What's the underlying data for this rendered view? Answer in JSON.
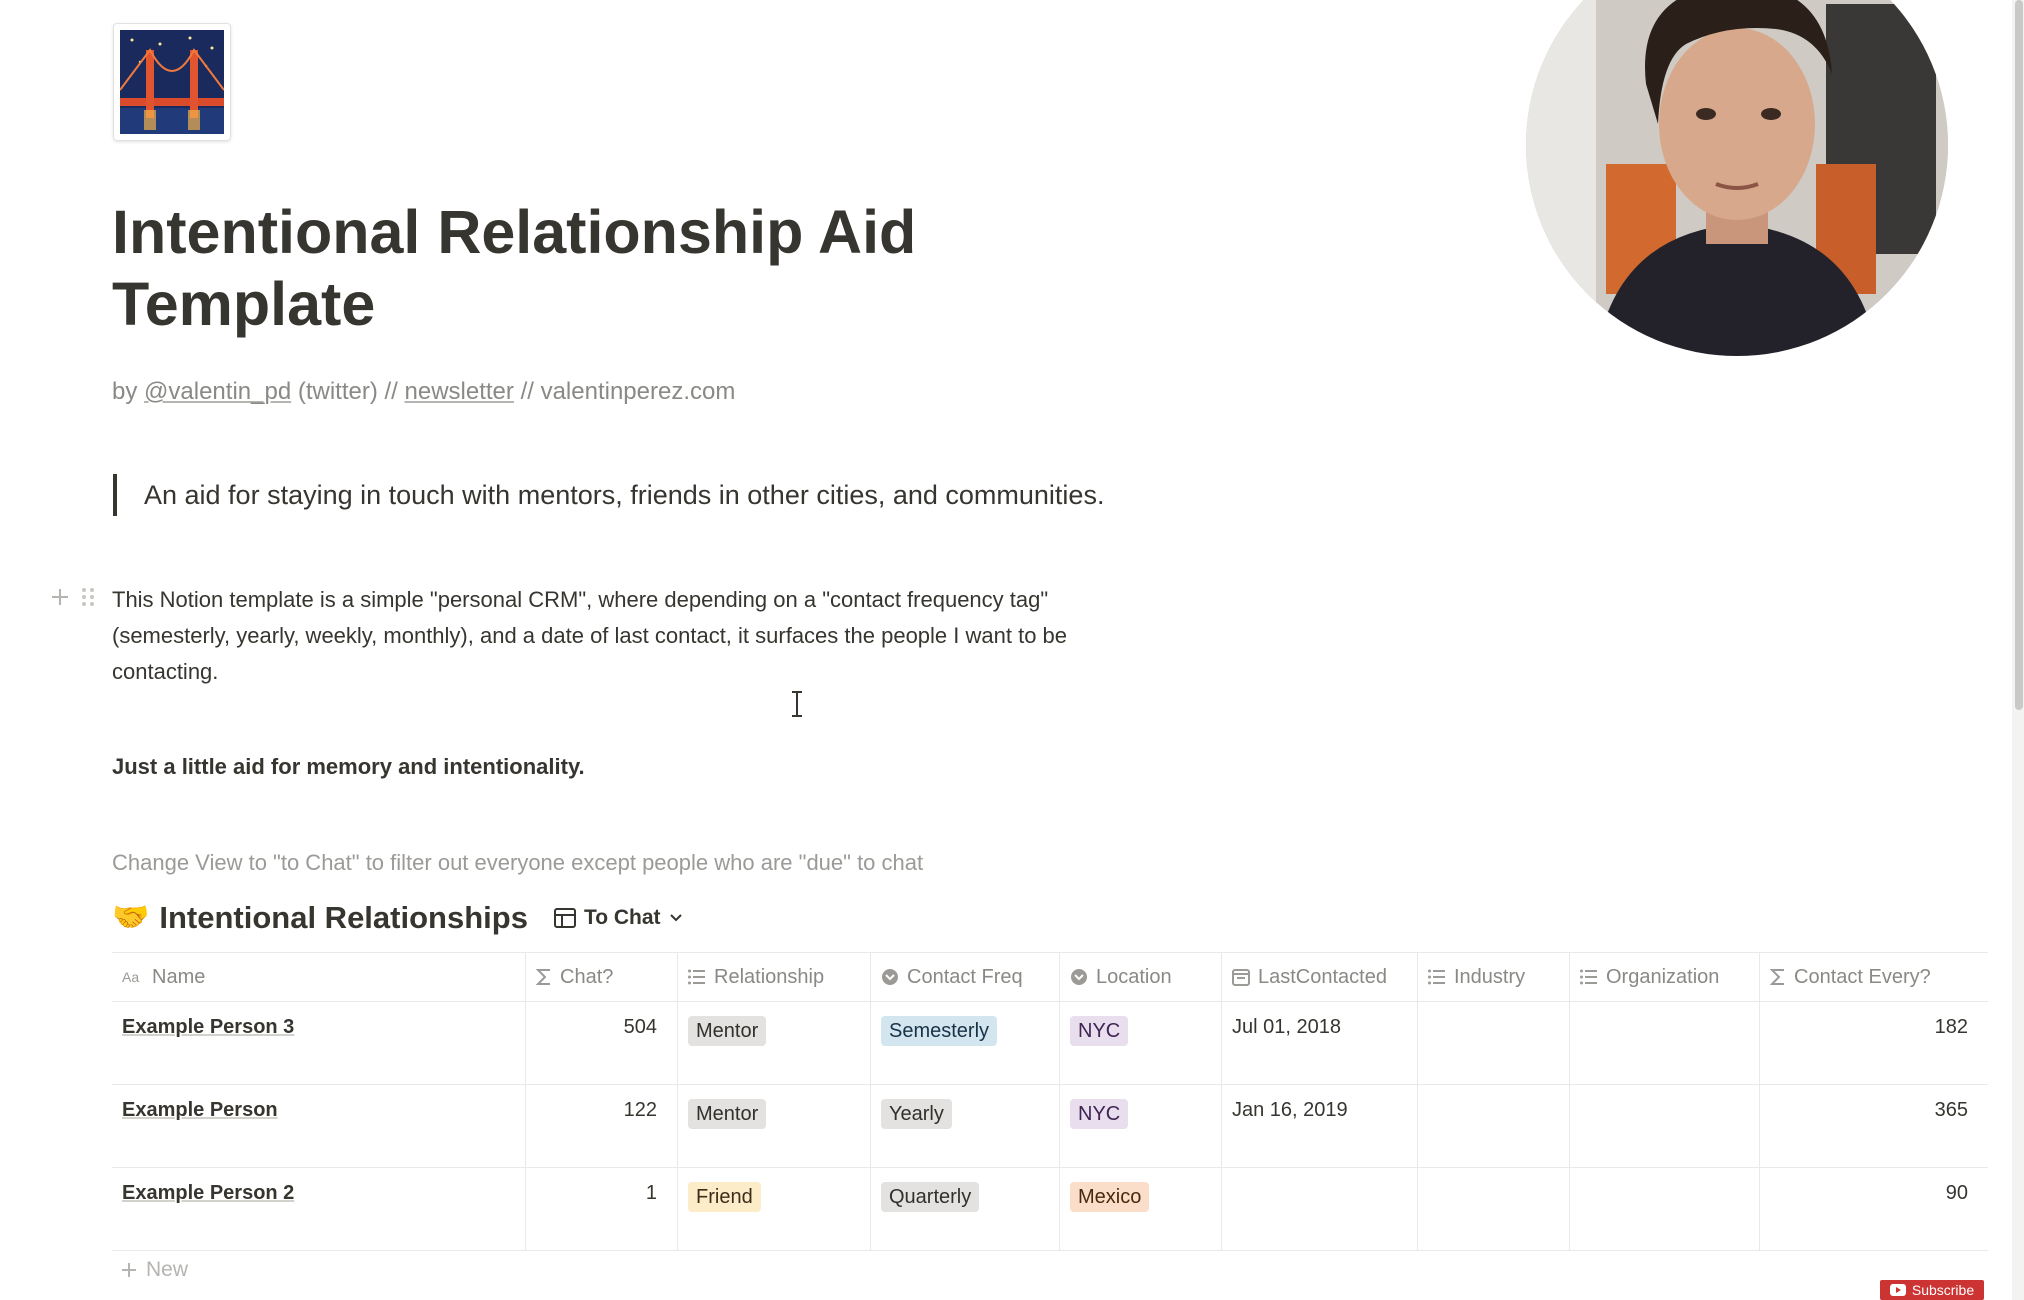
{
  "page": {
    "icon": "golden-gate-bridge-night",
    "title": "Intentional Relationship Aid Template",
    "byline": {
      "prefix": "by",
      "twitter_handle": "@valentin_pd",
      "twitter_note": "(twitter) //",
      "newsletter": "newsletter",
      "site": "// valentinperez.com"
    },
    "quote": "An aid for staying in touch with mentors, friends in other cities, and communities.",
    "paragraph": "This Notion template is a simple \"personal CRM\", where depending on a \"contact frequency tag\" (semesterly, yearly, weekly, monthly), and a date of last contact, it surfaces the people I want to be contacting.",
    "bold_line": "Just a little aid for memory and intentionality.",
    "hint": "Change View to \"to Chat\" to filter out everyone except people who are \"due\" to chat"
  },
  "database": {
    "emoji": "🤝",
    "title": "Intentional Relationships",
    "view_label": "To Chat",
    "columns": [
      {
        "label": "Name",
        "icon": "text-property-icon"
      },
      {
        "label": "Chat?",
        "icon": "formula-icon"
      },
      {
        "label": "Relationship",
        "icon": "multi-select-icon"
      },
      {
        "label": "Contact Freq",
        "icon": "select-icon"
      },
      {
        "label": "Location",
        "icon": "select-icon"
      },
      {
        "label": "LastContacted",
        "icon": "date-icon"
      },
      {
        "label": "Industry",
        "icon": "multi-select-icon"
      },
      {
        "label": "Organization",
        "icon": "multi-select-icon"
      },
      {
        "label": "Contact Every?",
        "icon": "formula-icon"
      }
    ],
    "rows": [
      {
        "name": "Example Person 3",
        "chat": "504",
        "relationship": "Mentor",
        "freq": "Semesterly",
        "location": "NYC",
        "last": "Jul 01, 2018",
        "industry": "",
        "organization": "",
        "every": "182"
      },
      {
        "name": "Example Person",
        "chat": "122",
        "relationship": "Mentor",
        "freq": "Yearly",
        "location": "NYC",
        "last": "Jan 16, 2019",
        "industry": "",
        "organization": "",
        "every": "365"
      },
      {
        "name": "Example Person 2",
        "chat": "1",
        "relationship": "Friend",
        "freq": "Quarterly",
        "location": "Mexico",
        "last": "",
        "industry": "",
        "organization": "",
        "every": "90"
      }
    ],
    "new_label": "New"
  },
  "tag_colors": {
    "gray_bg": "#e3e2e0",
    "gray_fg": "#32302c",
    "blue_bg": "#d3e5ef",
    "blue_fg": "#183347",
    "purple_bg": "#e8deee",
    "purple_fg": "#412454",
    "yellow_bg": "#fdecc8",
    "yellow_fg": "#402c1b",
    "orange_bg": "#fadec9",
    "orange_fg": "#49290e"
  },
  "video_overlay": {
    "subscribe_label": "Subscribe"
  }
}
